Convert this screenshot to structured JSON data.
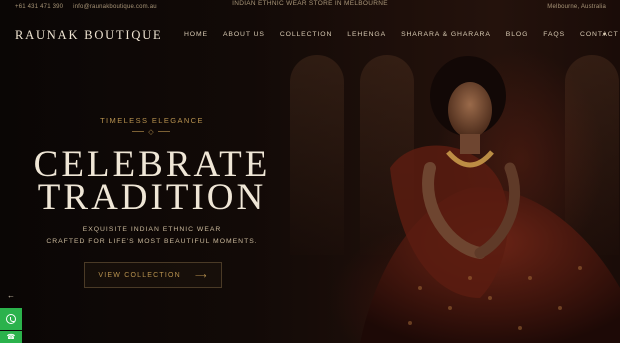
{
  "topbar": {
    "phone": "+61 431 471 390",
    "email": "info@raunakboutique.com.au",
    "tagline": "INDIAN ETHNIC WEAR STORE IN MELBOURNE",
    "location": "Melbourne, Australia"
  },
  "header": {
    "brand": "RAUNAK BOUTIQUE",
    "nav": [
      "HOME",
      "ABOUT US",
      "COLLECTION",
      "LEHENGA",
      "SHARARA & GHARARA",
      "BLOG",
      "FAQS",
      "CONTACT"
    ],
    "extra_icon": "chevron-down-icon"
  },
  "hero": {
    "eyebrow": "TIMELESS ELEGANCE",
    "ornament": "◇",
    "headline_1": "CELEBRATE",
    "headline_2": "TRADITION",
    "sub_1": "EXQUISITE INDIAN ETHNIC WEAR",
    "sub_2": "CRAFTED FOR LIFE'S MOST BEAUTIFUL MOMENTS.",
    "cta_label": "VIEW COLLECTION",
    "cta_arrow": "⟶"
  },
  "side": {
    "back_icon": "←",
    "whatsapp_icon": "whatsapp-icon",
    "phone_icon": "☎"
  },
  "colors": {
    "accent_gold": "#b8924f",
    "whatsapp_green": "#2bb24c",
    "background": "#0d0806"
  }
}
